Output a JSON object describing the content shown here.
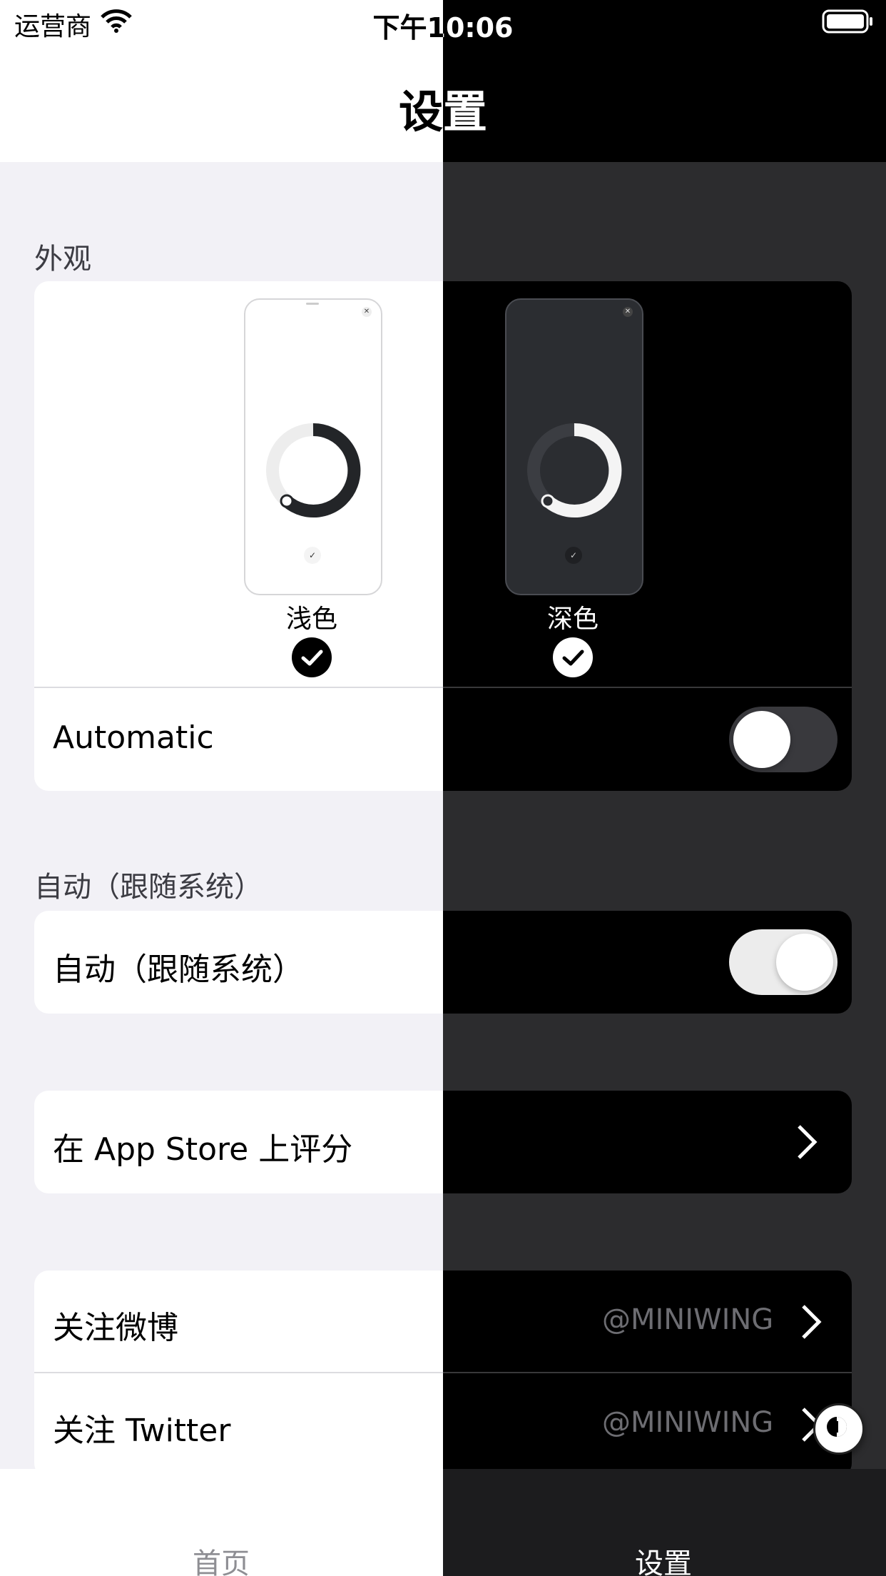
{
  "status_bar": {
    "carrier": "运营商",
    "time": "下午10:06"
  },
  "nav": {
    "title": "设置"
  },
  "appearance": {
    "header": "外观",
    "options": [
      {
        "label": "浅色"
      },
      {
        "label": "深色"
      }
    ],
    "automatic_label": "Automatic",
    "automatic_on": false
  },
  "auto_section": {
    "header": "自动（跟随系统）",
    "row_label": "自动（跟随系统）",
    "toggle_on": true
  },
  "rate": {
    "label": "在 App Store 上评分"
  },
  "follow": [
    {
      "label": "关注微博",
      "value": "@MINIWING"
    },
    {
      "label": "关注 Twitter",
      "value": "@MINIWING"
    }
  ],
  "tabs": [
    {
      "label": "首页"
    },
    {
      "label": "设置"
    }
  ],
  "colors": {
    "light_bg": "#f2f1f6",
    "dark_bg": "#2c2c2e",
    "card_dark": "#000000"
  }
}
